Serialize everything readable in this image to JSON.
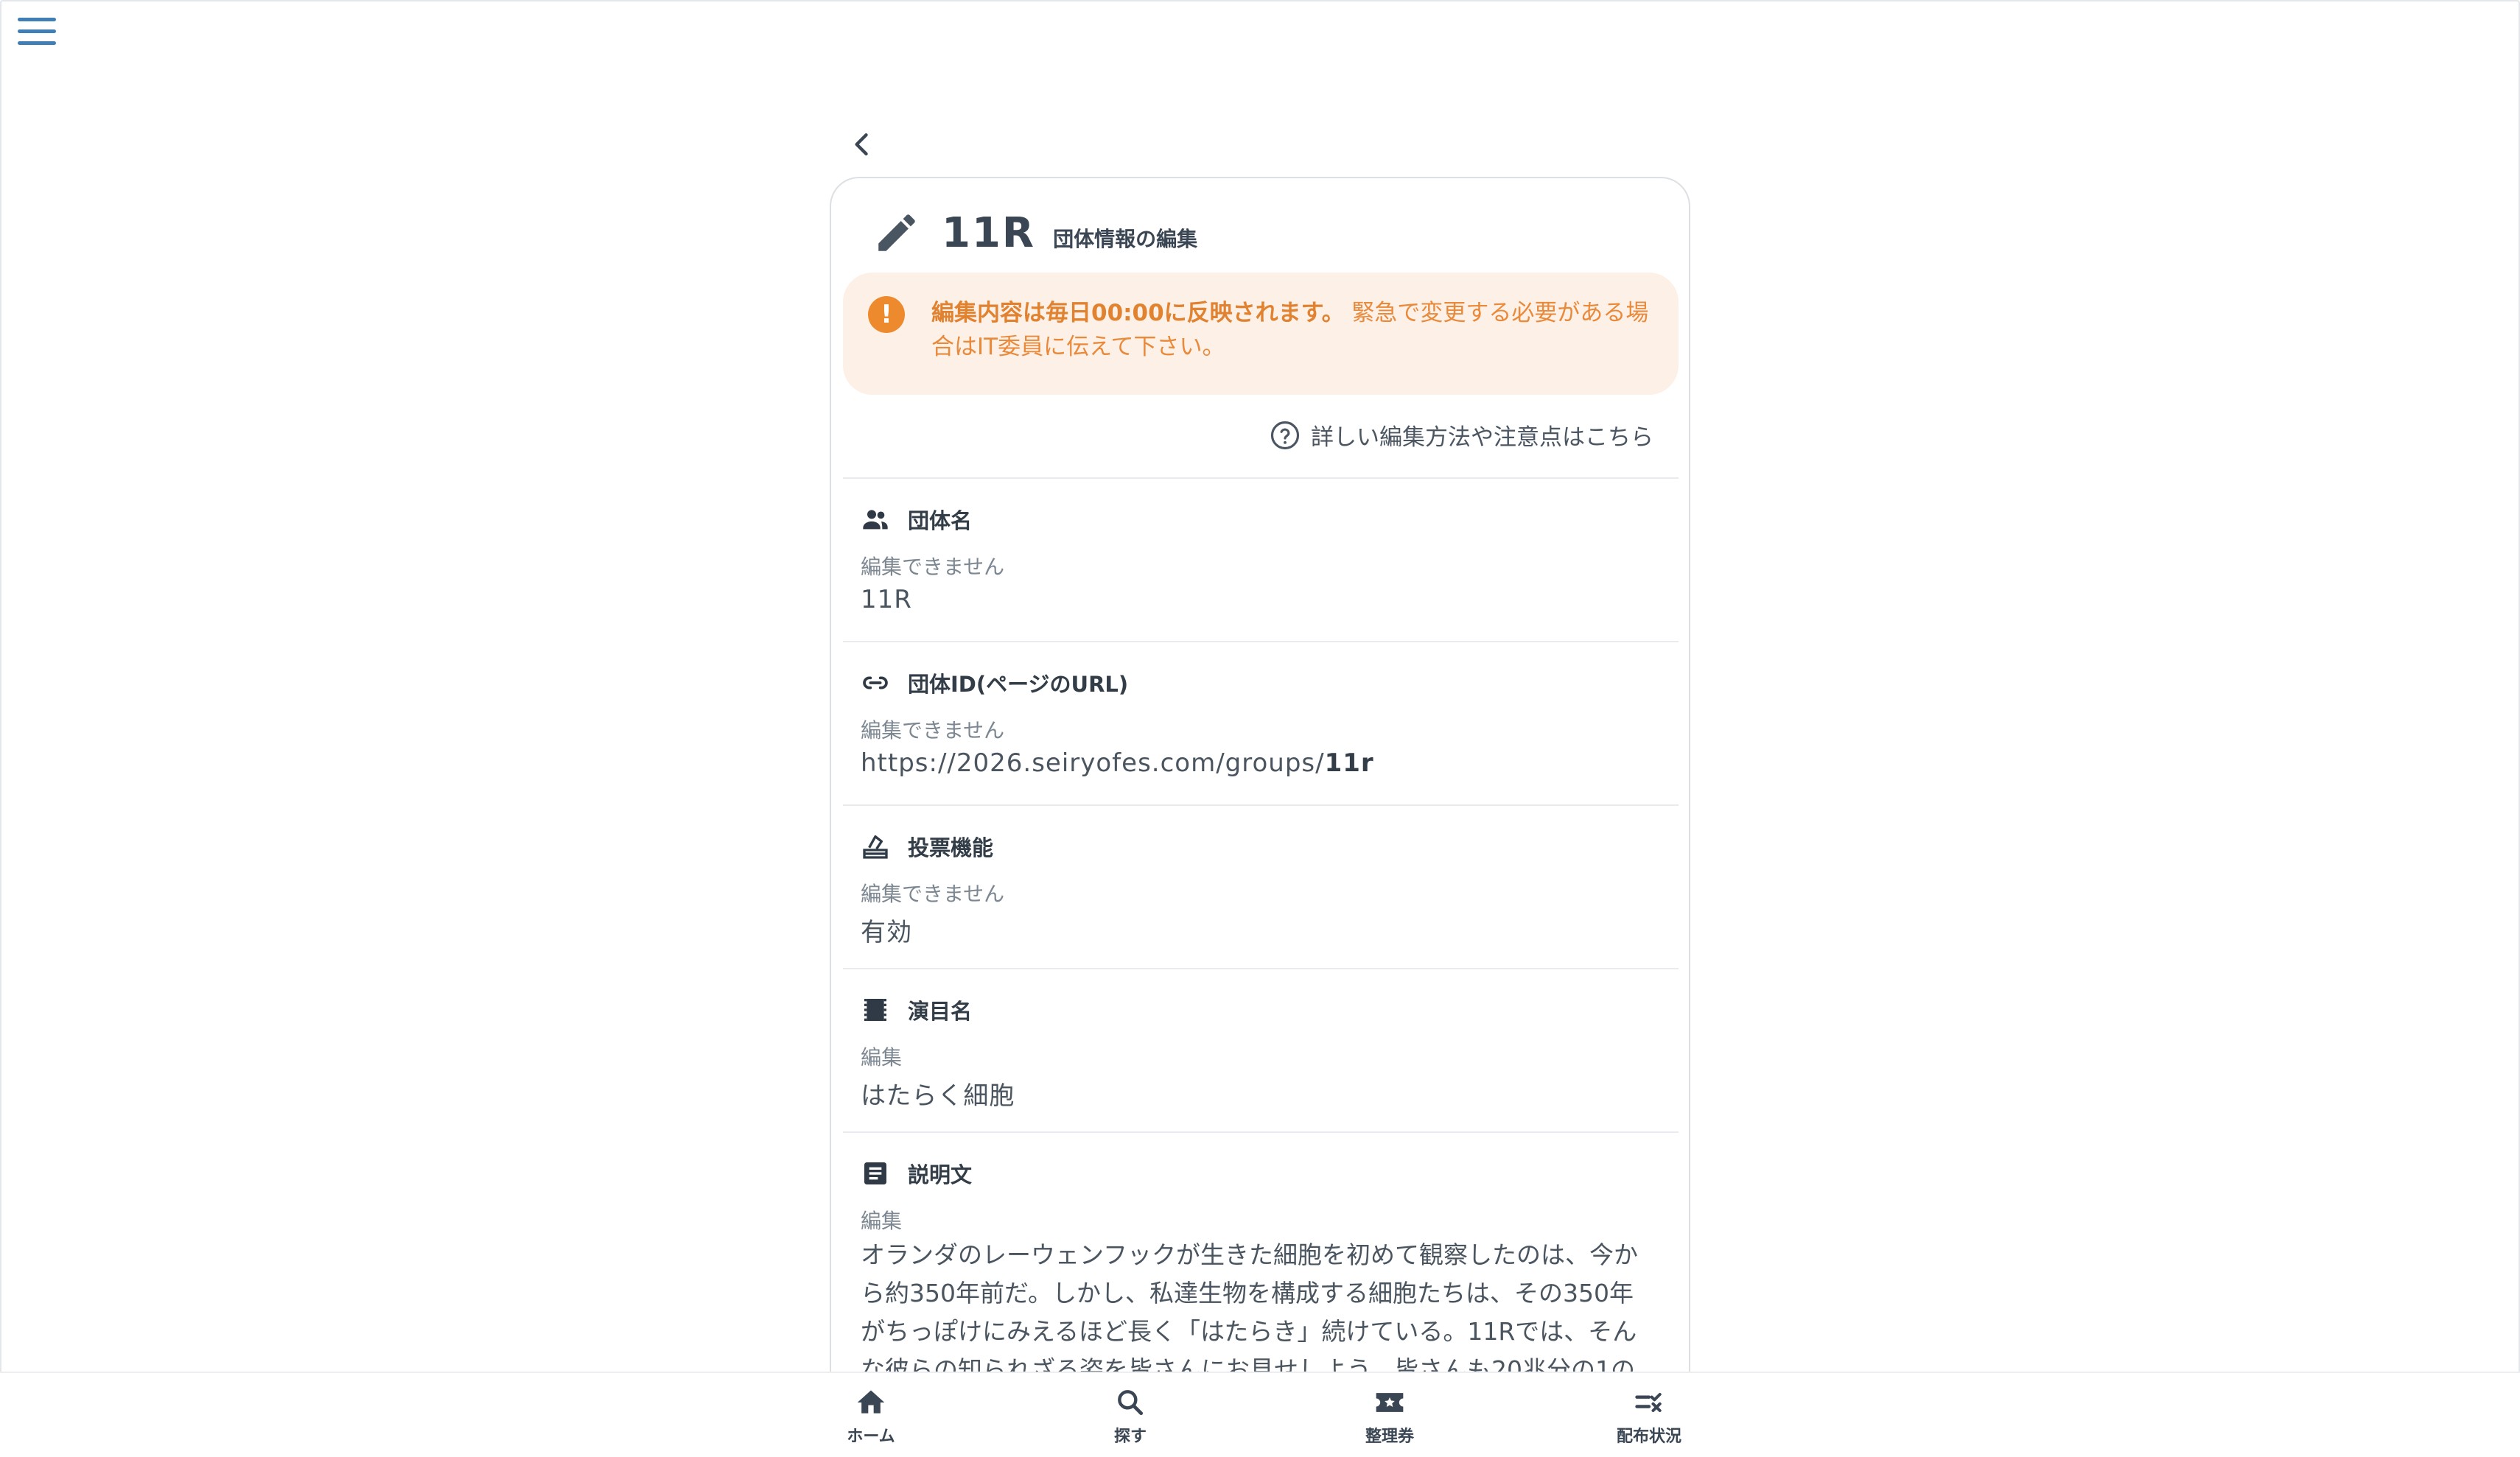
{
  "header": {
    "title": "11R",
    "subtitle": "団体情報の編集"
  },
  "notice": {
    "bold_text": "編集内容は毎日00:00に反映されます。",
    "text": "緊急で変更する必要がある場合はIT委員に伝えて下さい。",
    "icon": "exclamation-icon",
    "color": "#ee8a2e"
  },
  "help_link": "詳しい編集方法や注意点はこちら",
  "sections": [
    {
      "icon": "group-icon",
      "label": "団体名",
      "hint": "編集できません",
      "value": "11R"
    },
    {
      "icon": "link-icon",
      "label": "団体ID(ページのURL)",
      "hint": "編集できません",
      "value_prefix": "https://2026.seiryofes.com/groups/",
      "value_bold": "11r"
    },
    {
      "icon": "vote-icon",
      "label": "投票機能",
      "hint": "編集できません",
      "value": "有効"
    },
    {
      "icon": "movie-icon",
      "label": "演目名",
      "hint": "編集",
      "value": "はたらく細胞"
    },
    {
      "icon": "article-icon",
      "label": "説明文",
      "hint": "編集",
      "value": "オランダのレーウェンフックが生きた細胞を初めて観察したのは、今から約350年前だ。しかし、私達生物を構成する細胞たちは、その350年がちっぽけにみえるほど長く「はたらき」続けている。11Rでは、そんな彼らの知られざる姿を皆さんにお見せしよう。皆さんも20兆分の1の"
    }
  ],
  "bottom_nav": [
    {
      "icon": "home-icon",
      "label": "ホーム"
    },
    {
      "icon": "search-icon",
      "label": "探す"
    },
    {
      "icon": "ticket-icon",
      "label": "整理券"
    },
    {
      "icon": "checklist-icon",
      "label": "配布状況"
    }
  ],
  "colors": {
    "accent": "#3f7fb5",
    "warning": "#ee8a2e",
    "warning_bg": "#fdf0e6",
    "text": "#3a4654"
  }
}
